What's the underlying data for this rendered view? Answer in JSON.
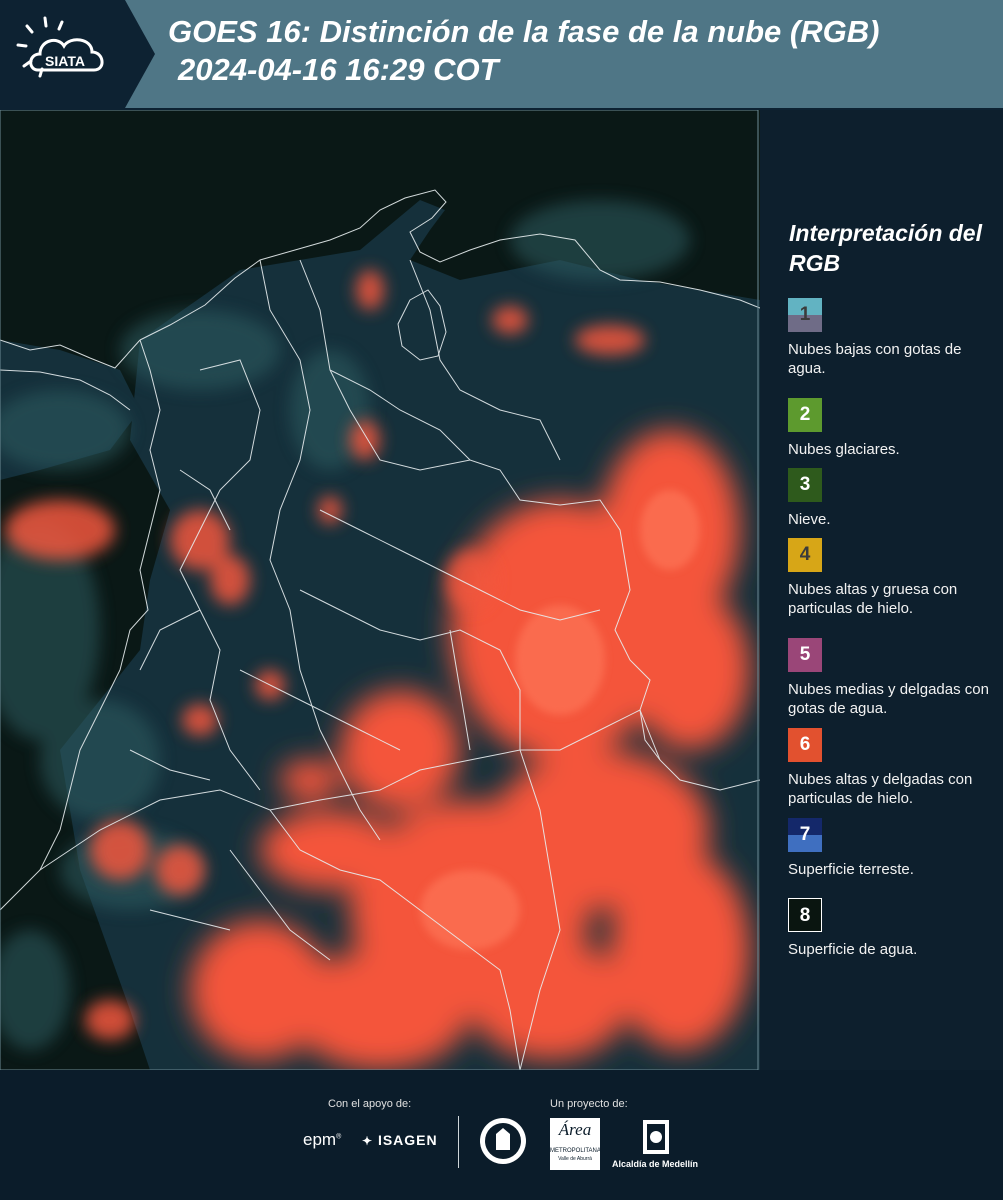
{
  "header": {
    "logo_text": "SIATA",
    "title_line1": "GOES 16: Distinción de la fase de la nube (RGB)",
    "title_line2": "2024-04-16 16:29 COT"
  },
  "legend": {
    "title": "Interpretación del RGB",
    "items": [
      {
        "number": "1",
        "label": "Nubes bajas con gotas de agua.",
        "color_top": "#62b3c2",
        "color_bottom": "#6f6c87"
      },
      {
        "number": "2",
        "label": "Nubes glaciares.",
        "color_top": "#5d9a2e",
        "color_bottom": "#5d9a2e"
      },
      {
        "number": "3",
        "label": "Nieve.",
        "color_top": "#2e5a1c",
        "color_bottom": "#2e5a1c"
      },
      {
        "number": "4",
        "label": "Nubes altas y gruesa con particulas de hielo.",
        "color_top": "#d7a617",
        "color_bottom": "#d7a617"
      },
      {
        "number": "5",
        "label": "Nubes medias y delgadas con gotas de agua.",
        "color_top": "#9a4678",
        "color_bottom": "#9a4678"
      },
      {
        "number": "6",
        "label": "Nubes altas y delgadas con particulas de hielo.",
        "color_top": "#e2512f",
        "color_bottom": "#e2512f"
      },
      {
        "number": "7",
        "label": "Superficie terreste.",
        "color_top": "#14286a",
        "color_bottom": "#3f6fc0"
      },
      {
        "number": "8",
        "label": "Superficie de agua.",
        "color_top": "#0a1510",
        "color_bottom": "#0a1510"
      }
    ]
  },
  "footer": {
    "support_label": "Con el apoyo de:",
    "project_label": "Un proyecto de:",
    "sponsor1": "epm",
    "sponsor2": "ISAGEN",
    "partner_amva": "Área",
    "amva_sub": "METROPOLITANA",
    "amva_sub2": "Valle de Aburrá",
    "partner_medellin": "Alcaldía de Medellín"
  },
  "colors": {
    "header_band": "#4f7686",
    "background": "#0b1c2a",
    "cloud_red": "#f4553a",
    "land": "#14303a"
  }
}
